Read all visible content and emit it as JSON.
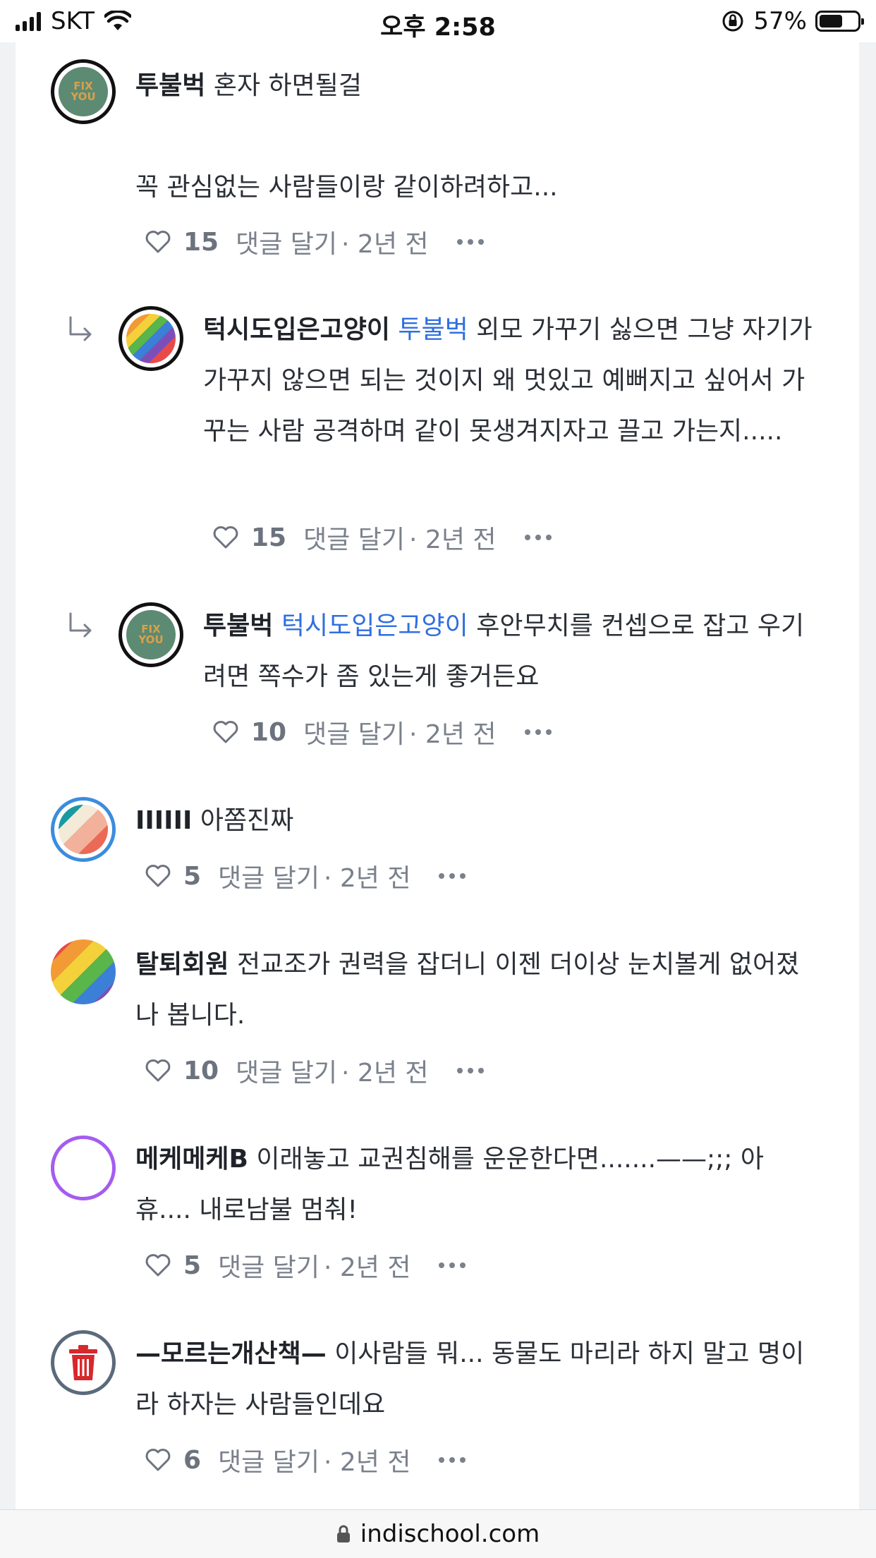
{
  "status": {
    "carrier": "SKT",
    "time": "오후 2:58",
    "battery_percent": "57%",
    "battery_level": 0.57
  },
  "url": "indischool.com",
  "comments": [
    {
      "author": "투불벅",
      "text": "혼자 하면될걸\n\n꼭 관심없는 사람들이랑 같이하려하고...",
      "likes": "15",
      "reply_label": "댓글 달기",
      "time": "· 2년 전",
      "avatar": "fix-you-avatar"
    },
    {
      "author": "턱시도입은고양이",
      "mention": "투불벅",
      "text": "외모 가꾸기 싫으면 그냥 자기가 가꾸지 않으면 되는 것이지 왜 멋있고 예뻐지고 싶어서 가꾸는 사람 공격하며 같이 못생겨지자고 끌고 가는지.....",
      "likes": "15",
      "reply_label": "댓글 달기",
      "time": "· 2년 전",
      "avatar": "rainbow-avatar"
    },
    {
      "author": "투불벅",
      "mention": "턱시도입은고양이",
      "text": "후안무치를 컨셉으로 잡고 우기려면 쪽수가 좀 있는게 좋거든요",
      "likes": "10",
      "reply_label": "댓글 달기",
      "time": "· 2년 전",
      "avatar": "fix-you-avatar"
    },
    {
      "author": "IIIIII",
      "text": "아쫌진짜",
      "likes": "5",
      "reply_label": "댓글 달기",
      "time": "· 2년 전",
      "avatar": "striped-avatar"
    },
    {
      "author": "탈퇴회원",
      "text": "전교조가 권력을 잡더니 이젠 더이상 눈치볼게 없어졌나 봅니다.",
      "likes": "10",
      "reply_label": "댓글 달기",
      "time": "· 2년 전",
      "avatar": "rainbow-avatar"
    },
    {
      "author": "메케메케B",
      "text": "이래놓고 교권침해를 운운한다면.......——;;; 아휴.... 내로남불 멈춰!",
      "likes": "5",
      "reply_label": "댓글 달기",
      "time": "· 2년 전",
      "avatar": "purple-ring-avatar"
    },
    {
      "author": "—모르는개산책—",
      "text": "이사람들 뭐... 동물도 마리라 하지 말고 명이라 하자는 사람들인데요",
      "likes": "6",
      "reply_label": "댓글 달기",
      "time": "· 2년 전",
      "avatar": "trash-icon"
    }
  ],
  "avatar_labels": {
    "fix_top": "FIX",
    "fix_bottom": "YOU"
  }
}
